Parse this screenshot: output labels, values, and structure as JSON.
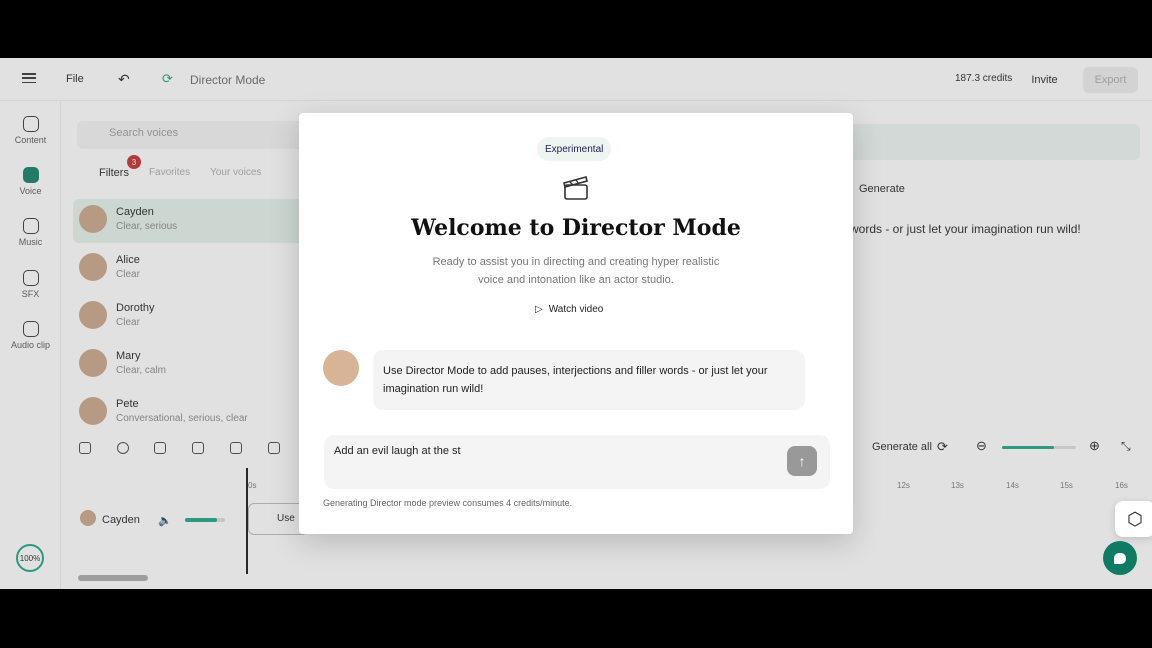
{
  "topbar": {
    "file_label": "File",
    "project_title": "Director Mode",
    "credits": "187.3 credits",
    "invite_label": "Invite",
    "export_label": "Export"
  },
  "rail": {
    "items": [
      {
        "label": "Content",
        "icon": "content-icon"
      },
      {
        "label": "Voice",
        "icon": "voice-icon"
      },
      {
        "label": "Music",
        "icon": "music-icon"
      },
      {
        "label": "SFX",
        "icon": "sfx-icon"
      },
      {
        "label": "Audio clip",
        "icon": "audio-clip-icon"
      }
    ],
    "zoom": "100%"
  },
  "panel": {
    "search_placeholder": "Search voices",
    "filters_label": "Filters",
    "filters_count": "3",
    "tab_favorites": "Favorites",
    "tab_your_voices": "Your voices",
    "voices": [
      {
        "name": "Cayden",
        "desc": "Clear, serious"
      },
      {
        "name": "Alice",
        "desc": "Clear"
      },
      {
        "name": "Dorothy",
        "desc": "Clear"
      },
      {
        "name": "Mary",
        "desc": "Clear, calm"
      },
      {
        "name": "Pete",
        "desc": "Conversational, serious, clear"
      }
    ]
  },
  "editor": {
    "generate_label": "Generate",
    "script_text": "words - or just let your imagination run wild!",
    "generate_all_label": "Generate all",
    "ruler": [
      "0s",
      "12s",
      "13s",
      "14s",
      "15s",
      "16s"
    ],
    "track_name": "Cayden",
    "clip_label": "Use"
  },
  "modal": {
    "chip": "Experimental",
    "title": "Welcome to Director Mode",
    "subtitle": "Ready to assist you in directing and creating hyper realistic voice and intonation like an actor studio.",
    "watch_label": "Watch video",
    "message": "Use Director Mode to add pauses, interjections and filler words - or just let your imagination run wild!",
    "input_value": "Add an evil laugh at the st",
    "footer": "Generating Director mode preview consumes 4 credits/minute."
  },
  "colors": {
    "accent": "#0e7b64",
    "badge": "#c62828"
  }
}
